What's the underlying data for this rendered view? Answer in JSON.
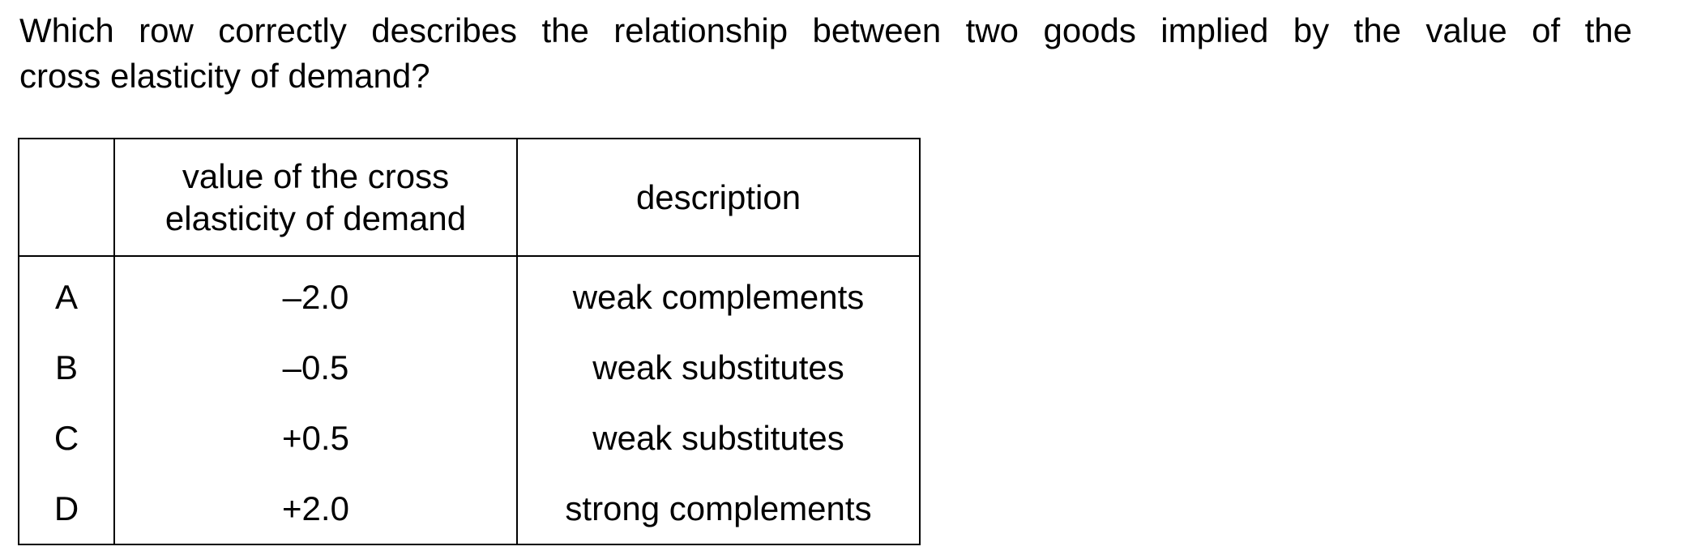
{
  "question": {
    "line1": "Which row correctly describes the relationship between two goods implied by the value of the",
    "line2": "cross elasticity of demand?"
  },
  "table": {
    "headers": {
      "letter": "",
      "value_line1": "value of the cross",
      "value_line2": "elasticity of demand",
      "description": "description"
    },
    "rows": [
      {
        "letter": "A",
        "value": "–2.0",
        "description": "weak complements"
      },
      {
        "letter": "B",
        "value": "–0.5",
        "description": "weak substitutes"
      },
      {
        "letter": "C",
        "value": "+0.5",
        "description": "weak substitutes"
      },
      {
        "letter": "D",
        "value": "+2.0",
        "description": "strong complements"
      }
    ]
  }
}
